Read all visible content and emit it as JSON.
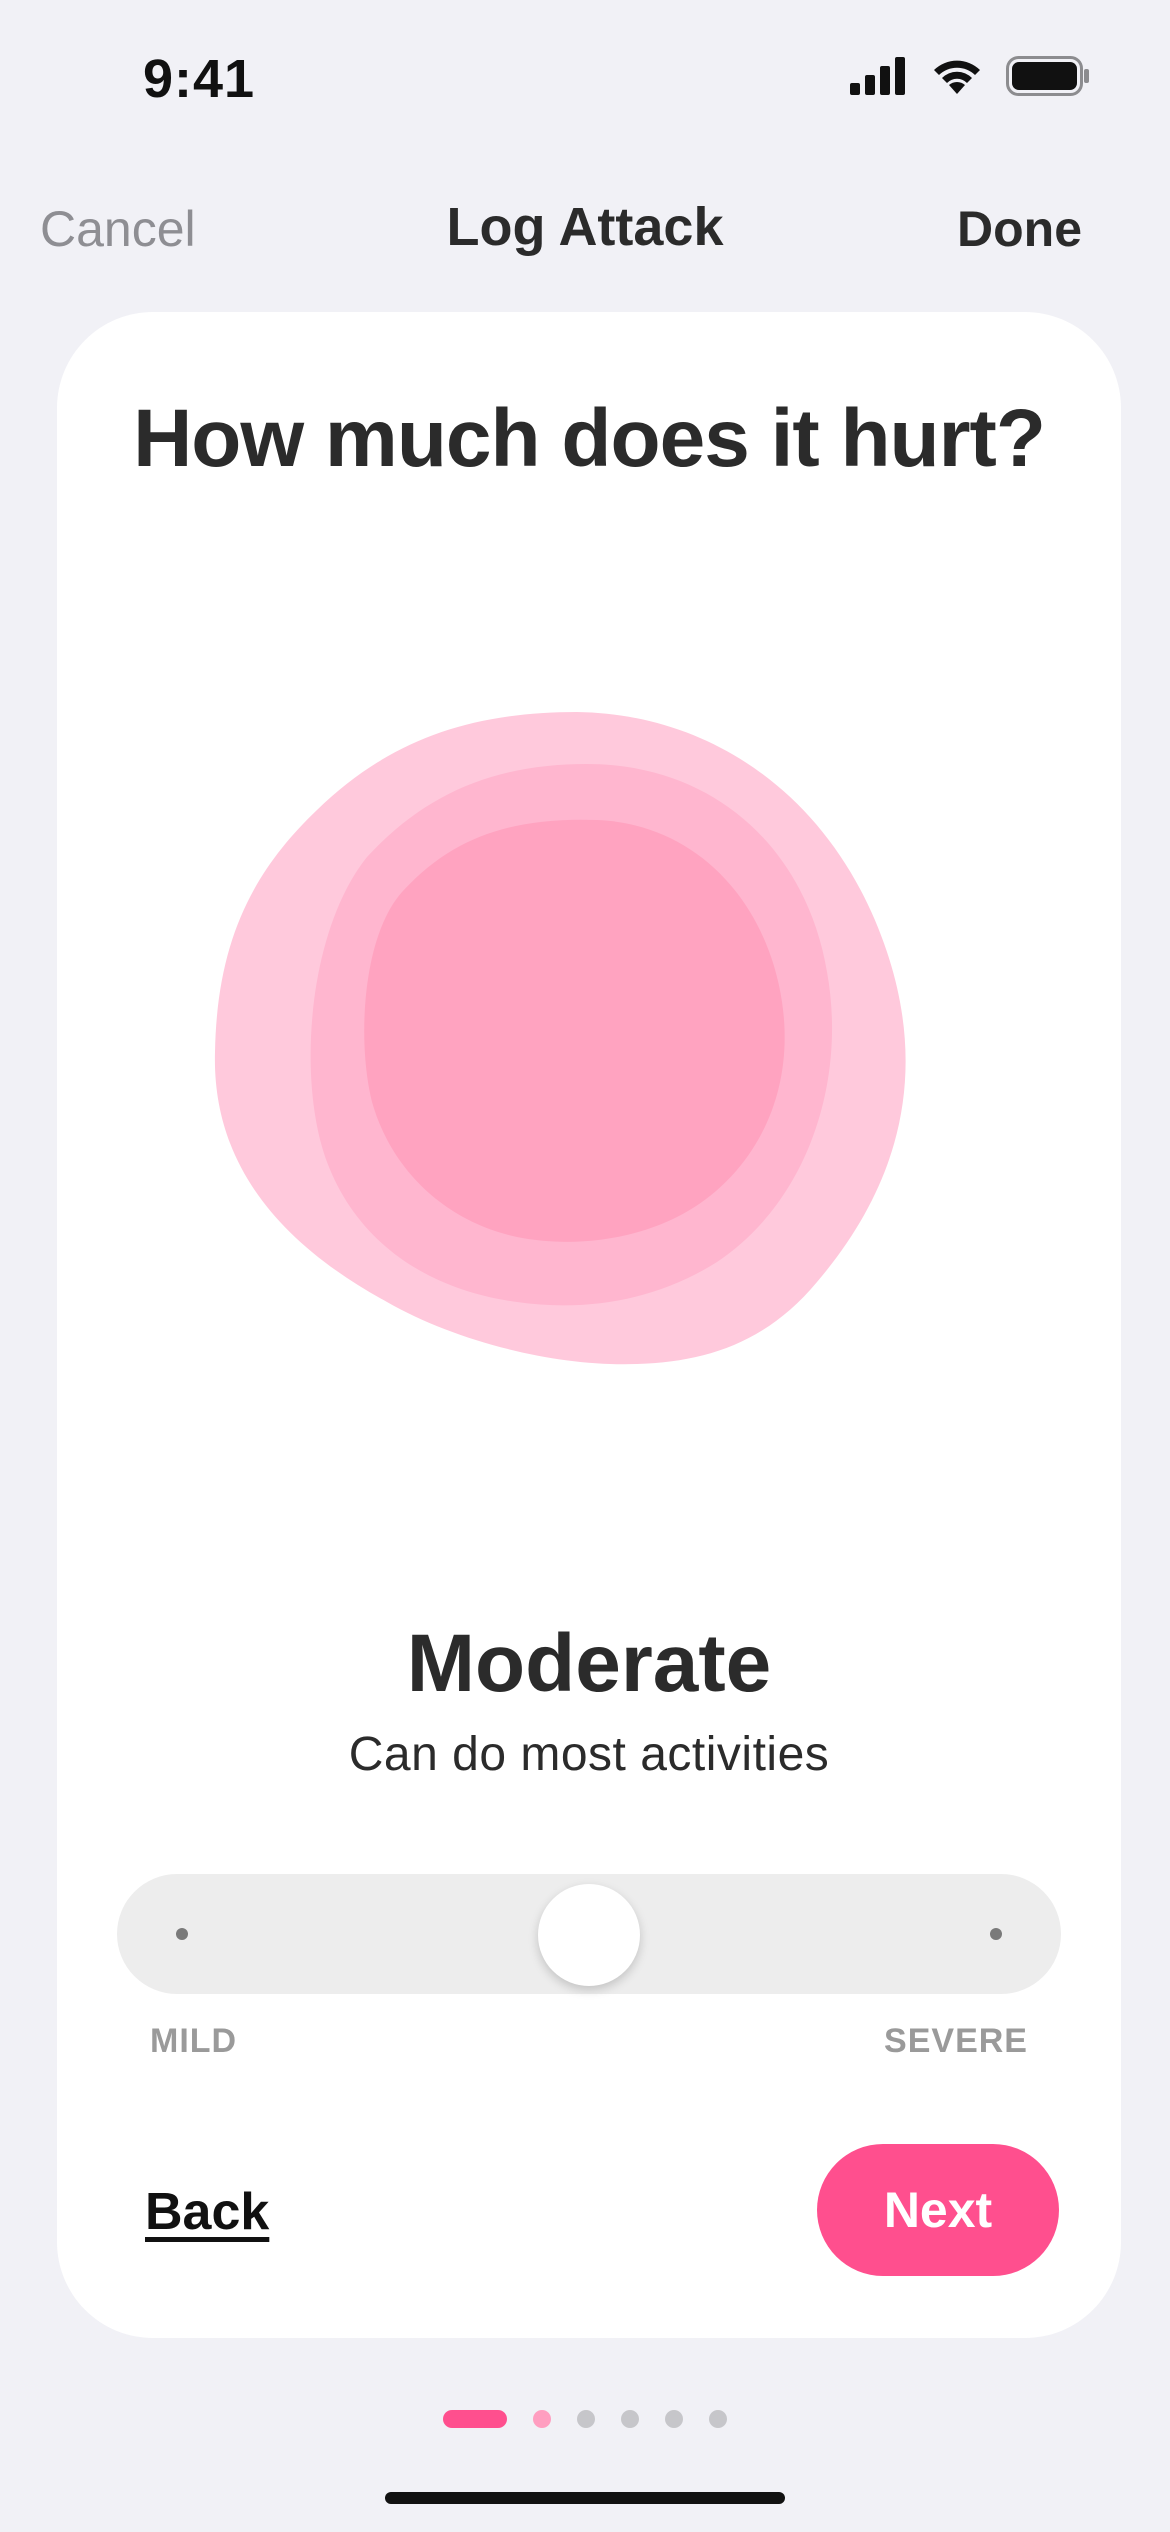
{
  "status_bar": {
    "time": "9:41",
    "icons": [
      "cellular-signal-icon",
      "wifi-icon",
      "battery-icon"
    ]
  },
  "nav": {
    "cancel_label": "Cancel",
    "title": "Log Attack",
    "done_label": "Done"
  },
  "card": {
    "question": "How much does it hurt?",
    "level_title": "Moderate",
    "level_description": "Can do most activities",
    "slider": {
      "value_fraction": 0.5,
      "min_label": "MILD",
      "max_label": "SEVERE"
    },
    "back_label": "Back",
    "next_label": "Next"
  },
  "pager": {
    "total": 6,
    "active_index": 0
  },
  "colors": {
    "accent": "#FF4F8E",
    "blob_outer": "#FFC9DC",
    "blob_middle": "#FFB6CF",
    "blob_inner": "#FFA3C0",
    "background": "#F1F1F6"
  }
}
